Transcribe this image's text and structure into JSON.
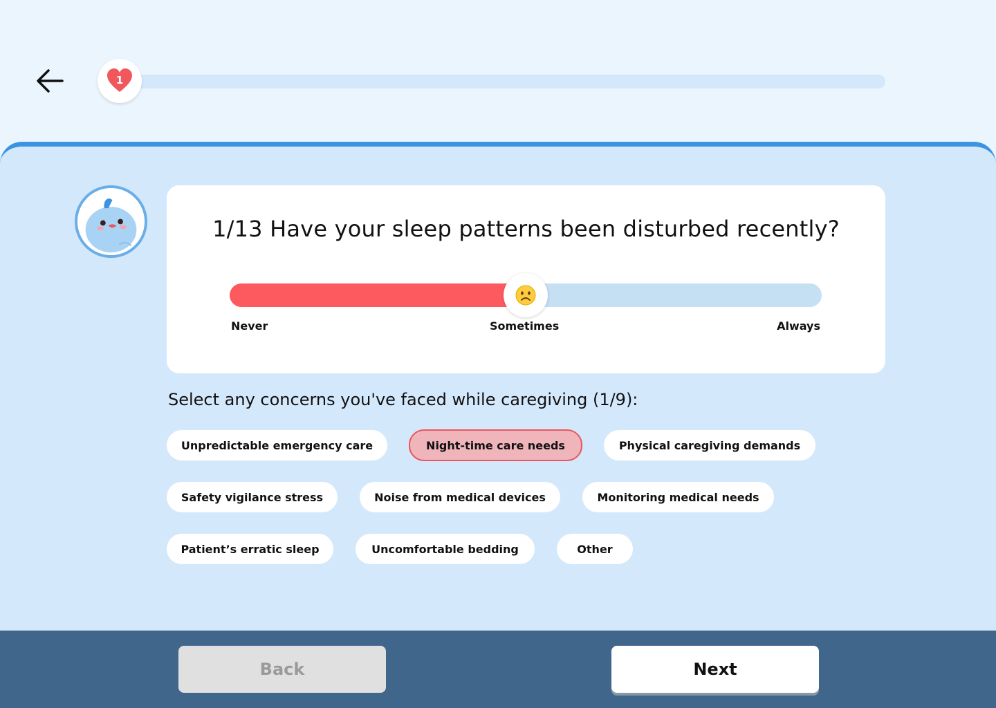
{
  "header": {
    "progress_badge": "1",
    "progress_fraction": 0.0
  },
  "question": {
    "title": "1/13 Have your sleep patterns been disturbed recently?",
    "scale": {
      "min_label": "Never",
      "mid_label": "Sometimes",
      "max_label": "Always",
      "value_fraction": 0.5,
      "knob_icon": "slightly-frowning-face-icon"
    }
  },
  "concerns": {
    "heading": "Select any concerns you've faced while caregiving (1/9):",
    "options": [
      {
        "label": "Unpredictable emergency care",
        "selected": false
      },
      {
        "label": "Night-time care needs",
        "selected": true
      },
      {
        "label": "Physical caregiving demands",
        "selected": false
      },
      {
        "label": "Safety vigilance stress",
        "selected": false
      },
      {
        "label": "Noise from medical devices",
        "selected": false
      },
      {
        "label": "Monitoring medical needs",
        "selected": false
      },
      {
        "label": "Patient’s erratic sleep",
        "selected": false
      },
      {
        "label": "Uncomfortable bedding",
        "selected": false
      },
      {
        "label": "Other",
        "selected": false
      }
    ]
  },
  "footer": {
    "back_label": "Back",
    "next_label": "Next"
  },
  "colors": {
    "accent_red": "#fd5a5f",
    "panel_blue": "#d4e8fc",
    "panel_border": "#3c93e2",
    "footer_bg": "#41668b"
  }
}
